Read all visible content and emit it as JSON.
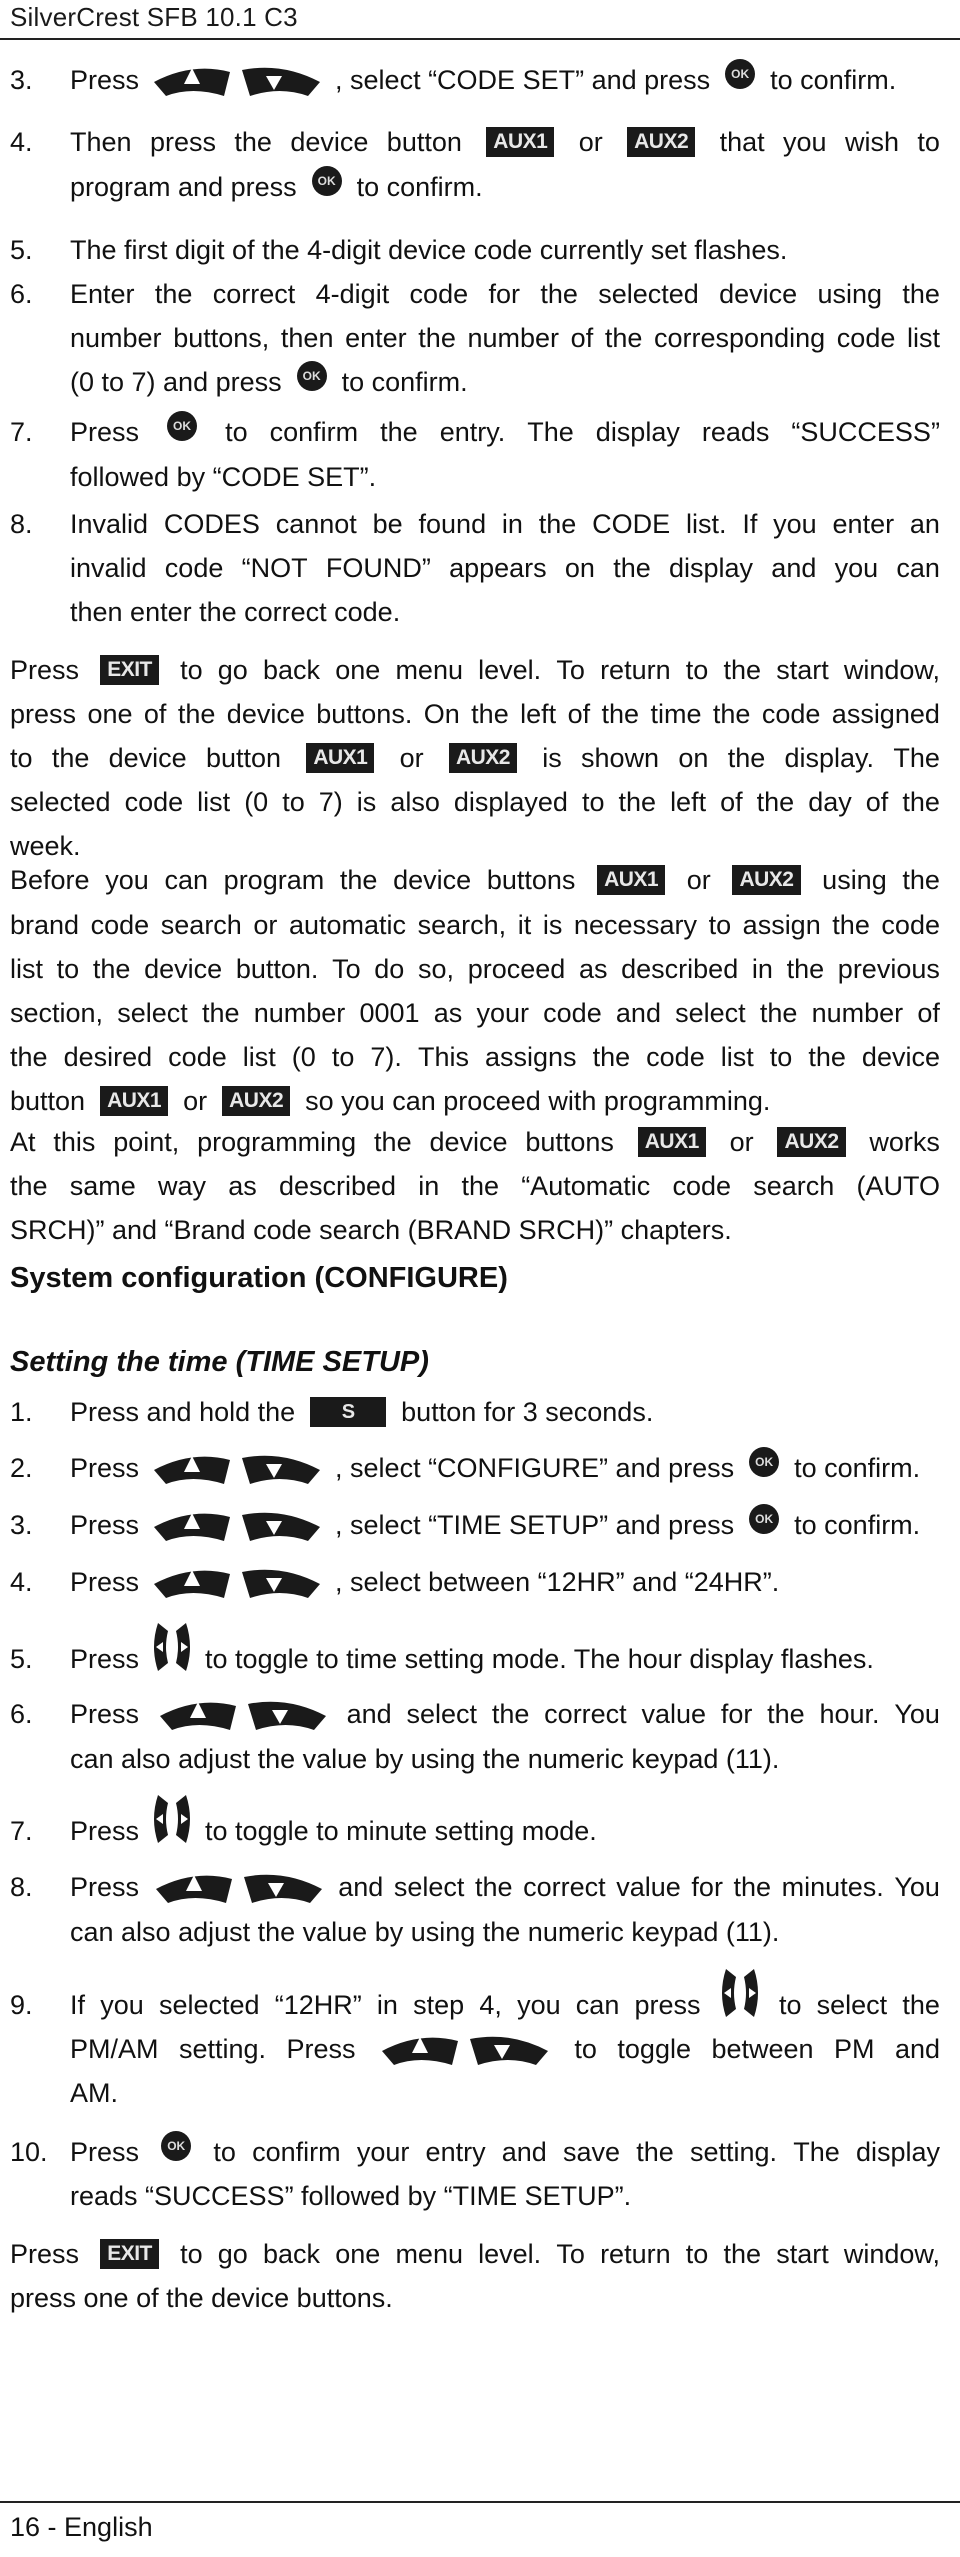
{
  "header": {
    "title": "SilverCrest SFB 10.1 C3"
  },
  "footer": {
    "page": "16 - English"
  },
  "icons": {
    "up_down": "up-down-arrow-keys",
    "left_right": "left-right-arrow-keys",
    "ok": "OK",
    "aux1": "AUX1",
    "aux2": "AUX2",
    "exit": "EXIT",
    "s": "S"
  },
  "section1": {
    "steps": [
      {
        "num": "3.",
        "lines": [
          [
            {
              "t": "Press"
            },
            {
              "i": "updown"
            },
            {
              "t": ", select “CODE SET” and press"
            },
            {
              "i": "ok"
            },
            {
              "t": "to confirm."
            }
          ]
        ]
      },
      {
        "num": "4.",
        "lines": [
          [
            {
              "t": "Then press the device button"
            },
            {
              "i": "aux1"
            },
            {
              "t": "or"
            },
            {
              "i": "aux2"
            },
            {
              "t": "that you wish to"
            }
          ],
          [
            {
              "t": "program and press"
            },
            {
              "i": "ok"
            },
            {
              "t": "to confirm."
            }
          ]
        ]
      },
      {
        "num": "5.",
        "lines": [
          [
            {
              "t": "The first digit of the 4-digit device code currently set flashes."
            }
          ]
        ]
      },
      {
        "num": "6.",
        "lines": [
          [
            {
              "t": "Enter the correct 4-digit code for the selected device using the"
            }
          ],
          [
            {
              "t": "number buttons, then enter the number of the corresponding code list"
            }
          ],
          [
            {
              "t": "(0 to 7) and press"
            },
            {
              "i": "ok"
            },
            {
              "t": "to confirm."
            }
          ]
        ]
      },
      {
        "num": "7.",
        "lines": [
          [
            {
              "t": "Press"
            },
            {
              "i": "ok"
            },
            {
              "t": "to confirm the entry. The display reads “SUCCESS”"
            }
          ],
          [
            {
              "t": "followed by “CODE SET”."
            }
          ]
        ]
      },
      {
        "num": "8.",
        "lines": [
          [
            {
              "t": "Invalid CODES cannot be found in the CODE list. If you enter an"
            }
          ],
          [
            {
              "t": "invalid code “NOT FOUND” appears on the display and you can"
            }
          ],
          [
            {
              "t": "then enter the correct code."
            }
          ]
        ]
      }
    ],
    "paragraphs": [
      {
        "lines": [
          [
            {
              "t": "Press"
            },
            {
              "i": "exit"
            },
            {
              "t": "to go back one menu level. To return to the start window,"
            }
          ],
          [
            {
              "t": "press one of the device buttons. On the left of the time the code assigned"
            }
          ],
          [
            {
              "t": "to the device button"
            },
            {
              "i": "aux1"
            },
            {
              "t": "or"
            },
            {
              "i": "aux2"
            },
            {
              "t": "is shown on the display. The"
            }
          ],
          [
            {
              "t": "selected code list (0 to 7) is also displayed to the left of the day of the"
            }
          ],
          [
            {
              "t": "week."
            }
          ]
        ]
      },
      {
        "lines": [
          [
            {
              "t": "Before you can program the device buttons"
            },
            {
              "i": "aux1"
            },
            {
              "t": "or"
            },
            {
              "i": "aux2"
            },
            {
              "t": "using the"
            }
          ],
          [
            {
              "t": "brand code search or automatic search, it is necessary to assign the code"
            }
          ],
          [
            {
              "t": "list to the device button. To do so, proceed as described in the previous"
            }
          ],
          [
            {
              "t": "section, select the number 0001 as your code and select the number of"
            }
          ],
          [
            {
              "t": "the desired code list (0 to 7). This assigns the code list to the device"
            }
          ],
          [
            {
              "t": "button"
            },
            {
              "i": "aux1"
            },
            {
              "t": "or"
            },
            {
              "i": "aux2"
            },
            {
              "t": "so you can proceed with programming."
            }
          ],
          [
            {
              "t": "At this point, programming the device buttons"
            },
            {
              "i": "aux1"
            },
            {
              "t": "or"
            },
            {
              "i": "aux2"
            },
            {
              "t": "works"
            }
          ],
          [
            {
              "t": "the same way as described in the “Automatic code search (AUTO"
            }
          ],
          [
            {
              "t": "SRCH)” and “Brand code search (BRAND SRCH)” chapters."
            }
          ]
        ]
      }
    ]
  },
  "section2": {
    "heading": "System configuration (CONFIGURE)",
    "subheading": "Setting the time (TIME SETUP)",
    "steps": [
      {
        "num": "1.",
        "lines": [
          [
            {
              "t": "Press and hold the"
            },
            {
              "i": "s"
            },
            {
              "t": "button for 3 seconds."
            }
          ]
        ]
      },
      {
        "num": "2.",
        "lines": [
          [
            {
              "t": "Press"
            },
            {
              "i": "updown"
            },
            {
              "t": ", select “CONFIGURE” and press"
            },
            {
              "i": "ok"
            },
            {
              "t": "to confirm."
            }
          ]
        ]
      },
      {
        "num": "3.",
        "lines": [
          [
            {
              "t": "Press"
            },
            {
              "i": "updown"
            },
            {
              "t": ", select “TIME SETUP” and press"
            },
            {
              "i": "ok"
            },
            {
              "t": "to confirm."
            }
          ]
        ]
      },
      {
        "num": "4.",
        "lines": [
          [
            {
              "t": "Press"
            },
            {
              "i": "updown"
            },
            {
              "t": ", select between “12HR” and “24HR”."
            }
          ]
        ]
      },
      {
        "num": "5.",
        "lines": [
          [
            {
              "t": "Press"
            },
            {
              "i": "leftright"
            },
            {
              "t": "to toggle to time setting mode. The hour display flashes."
            }
          ]
        ]
      },
      {
        "num": "6.",
        "lines": [
          [
            {
              "t": "Press"
            },
            {
              "i": "updown"
            },
            {
              "t": "and select the correct value for the hour. You"
            }
          ],
          [
            {
              "t": "can also adjust the value by using the numeric keypad (11)."
            }
          ]
        ]
      },
      {
        "num": "7.",
        "lines": [
          [
            {
              "t": "Press"
            },
            {
              "i": "leftright"
            },
            {
              "t": "to toggle to minute setting mode."
            }
          ]
        ]
      },
      {
        "num": "8.",
        "lines": [
          [
            {
              "t": "Press"
            },
            {
              "i": "updown"
            },
            {
              "t": "and select the correct value for the minutes. You"
            }
          ],
          [
            {
              "t": "can also adjust the value by using the numeric keypad (11)."
            }
          ]
        ]
      },
      {
        "num": "9.",
        "lines": [
          [
            {
              "t": "If you selected “12HR” in step 4,  you can press"
            },
            {
              "i": "leftright"
            },
            {
              "t": "to select the"
            }
          ],
          [
            {
              "t": "PM/AM setting. Press"
            },
            {
              "i": "updown"
            },
            {
              "t": "to toggle between PM and"
            }
          ],
          [
            {
              "t": "AM."
            }
          ]
        ]
      },
      {
        "num": "10.",
        "lines": [
          [
            {
              "t": "Press"
            },
            {
              "i": "ok"
            },
            {
              "t": "to confirm your entry and save the setting. The display"
            }
          ],
          [
            {
              "t": "reads “SUCCESS” followed by “TIME SETUP”."
            }
          ]
        ]
      }
    ],
    "closing": {
      "lines": [
        [
          {
            "t": "Press"
          },
          {
            "i": "exit"
          },
          {
            "t": "to go back one menu level. To return to the start window,"
          }
        ],
        [
          {
            "t": "press one of the device buttons."
          }
        ]
      ]
    }
  }
}
